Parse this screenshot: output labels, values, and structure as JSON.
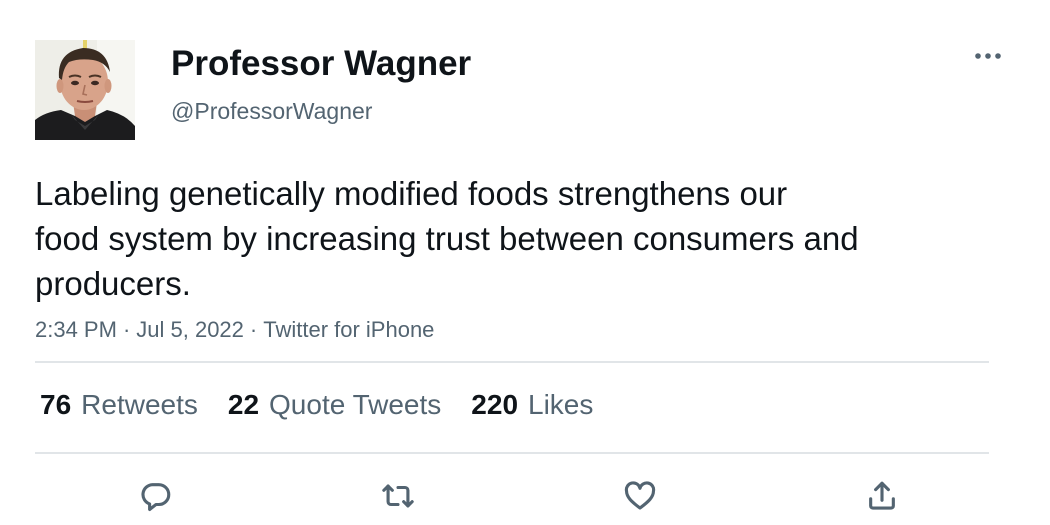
{
  "author": {
    "display_name": "Professor Wagner",
    "handle": "@ProfessorWagner",
    "avatar_icon": "profile-photo"
  },
  "tweet": {
    "text_lines": [
      "Labeling genetically modified foods strengthens our",
      "food system by increasing trust between consumers and",
      "producers."
    ],
    "time": "2:34 PM",
    "date": "Jul 5, 2022",
    "source": "Twitter for iPhone",
    "separator": "·"
  },
  "stats": {
    "retweets": {
      "count": "76",
      "label": "Retweets"
    },
    "quote_tweets": {
      "count": "22",
      "label": "Quote Tweets"
    },
    "likes": {
      "count": "220",
      "label": "Likes"
    }
  },
  "icons": {
    "more": "more-horizontal-icon",
    "reply": "reply-icon",
    "retweet": "retweet-icon",
    "like": "heart-icon",
    "share": "share-icon"
  },
  "colors": {
    "text_primary": "#0f1419",
    "text_secondary": "#536471",
    "divider": "#e1e5e8",
    "background": "#ffffff"
  }
}
